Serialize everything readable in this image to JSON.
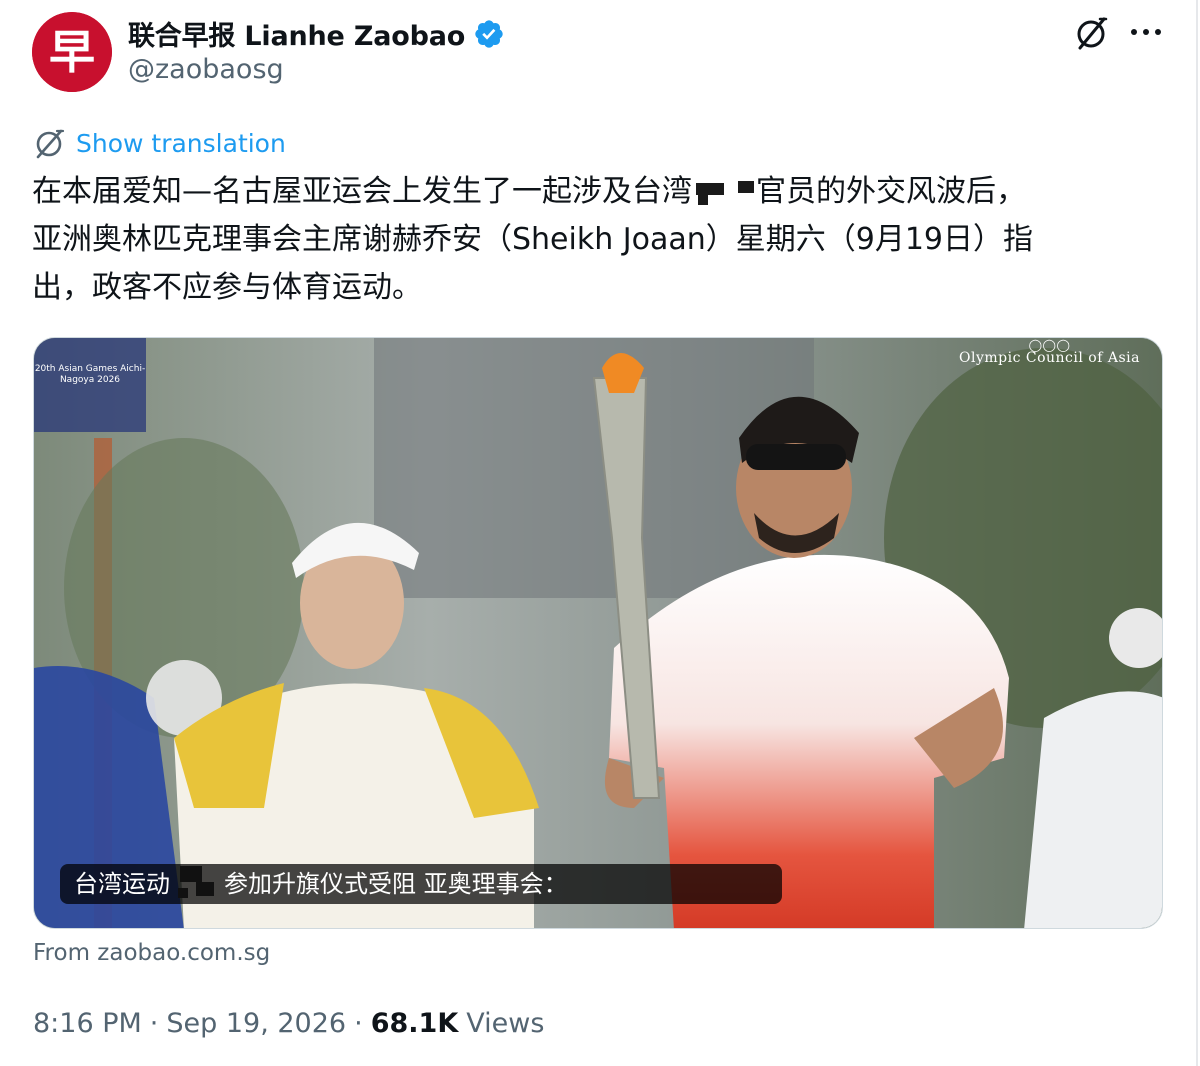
{
  "author": {
    "display_name": "联合早报 Lianhe Zaobao",
    "handle": "@zaobaosg",
    "avatar_glyph": "早",
    "verified": true,
    "avatar_color": "#c8102e",
    "verified_color": "#1d9bf0"
  },
  "actions": {
    "grok_icon": "grok-slash-icon",
    "more_icon": "more-horizontal-icon"
  },
  "translation": {
    "label": "Show translation",
    "icon": "translate-globe-icon"
  },
  "tweet": {
    "line1_a": "在本届爱知—名古屋亚运会上发生了一起涉及台湾",
    "line1_b": "官员的外交风波后，",
    "line2": "亚洲奥林匹克理事会主席谢赫乔安（Sheikh Joaan）星期六（9月19日）指",
    "line3": "出，政客不应参与体育运动。"
  },
  "media": {
    "caption_a": "台湾运动",
    "caption_b": "参加升旗仪式受阻 亚奥理事会：",
    "overlay_brand": "Olympic Council of Asia",
    "games_logo_text": "20th Asian Games Aichi-Nagoya 2026"
  },
  "source": {
    "text": "From zaobao.com.sg"
  },
  "meta": {
    "time": "8:16 PM",
    "date": "Sep 19, 2026",
    "views_count": "68.1K",
    "views_label": "Views"
  }
}
